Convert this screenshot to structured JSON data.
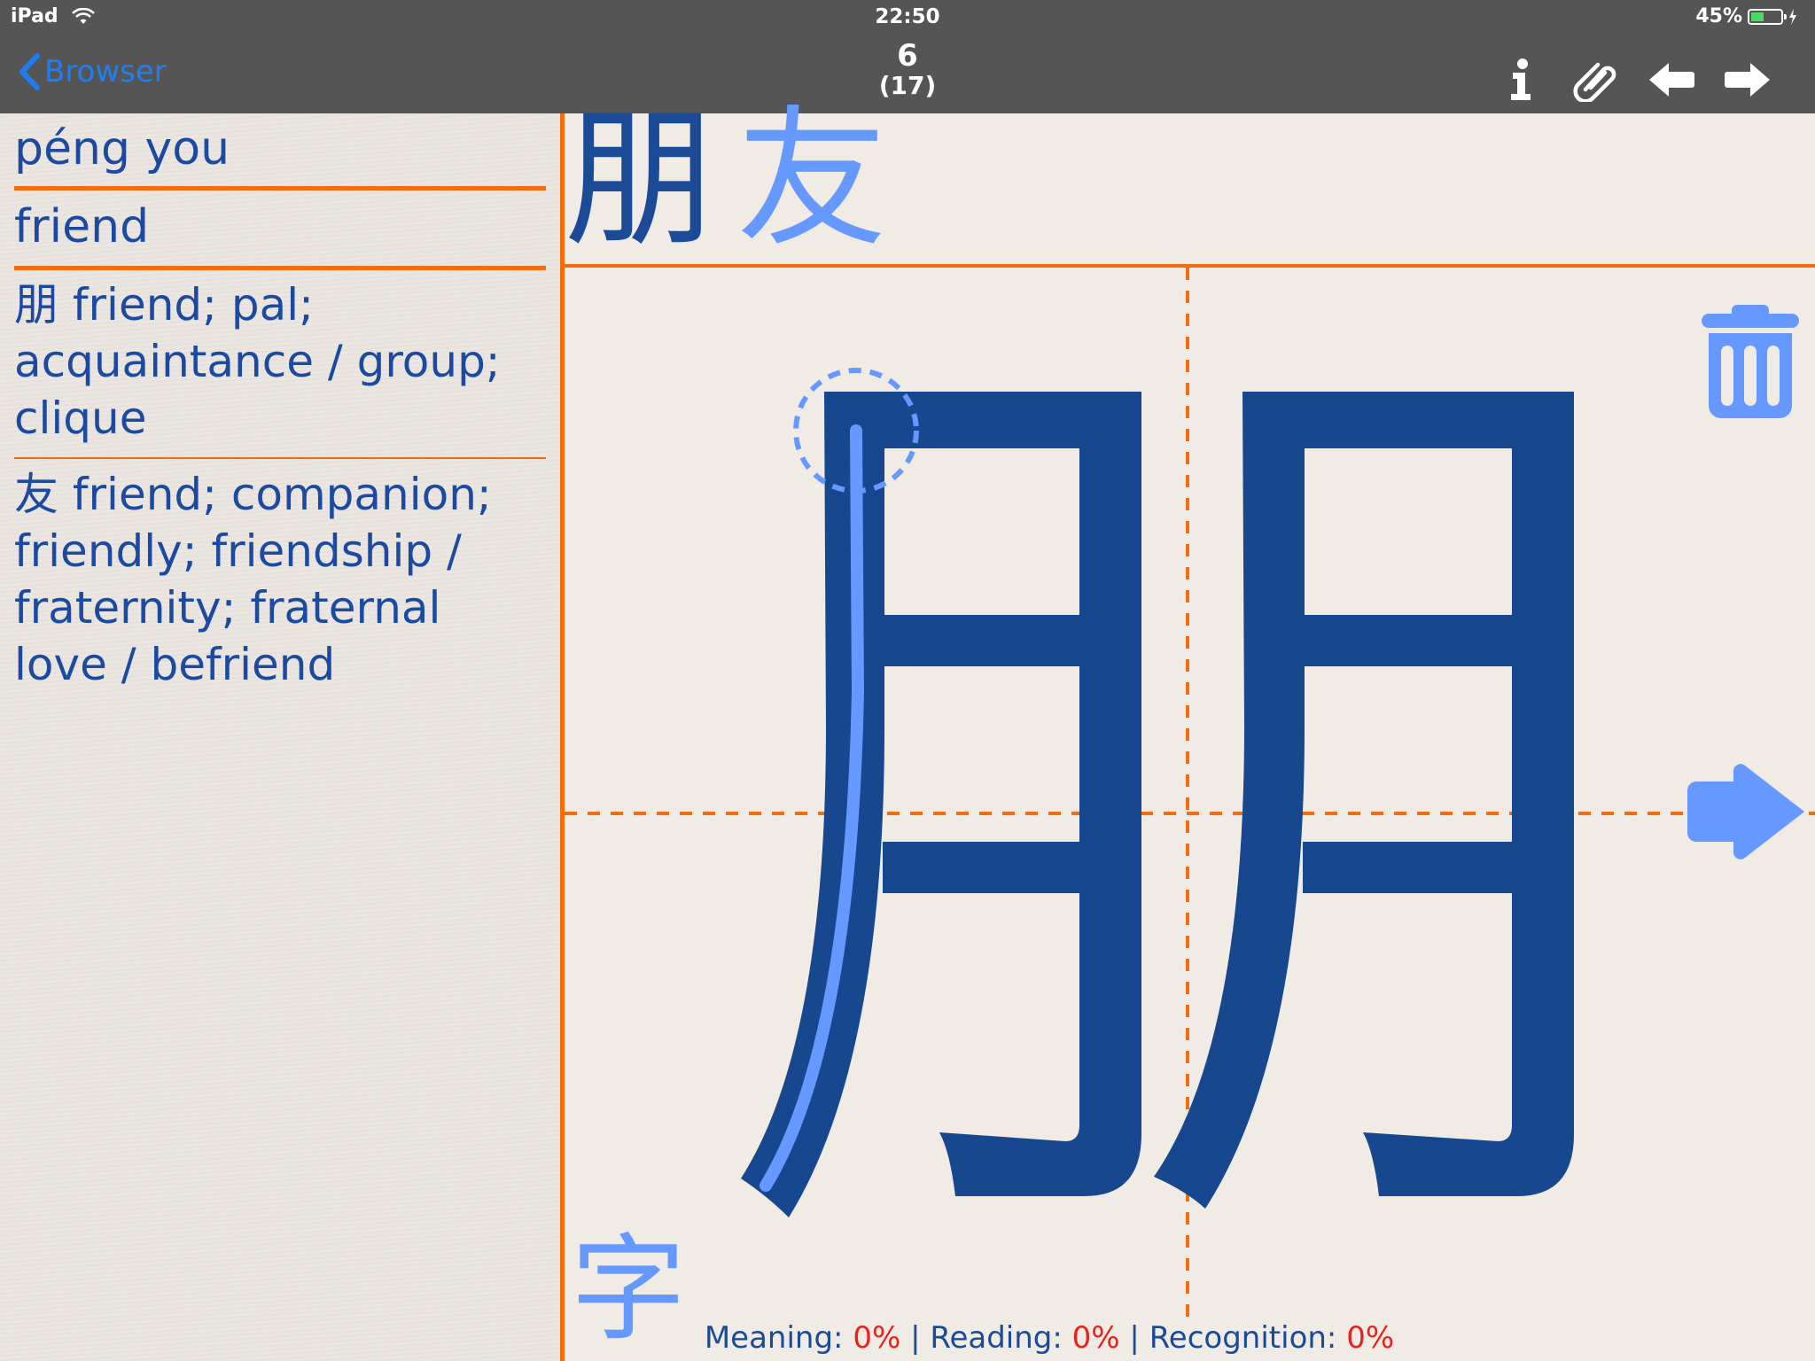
{
  "status_bar": {
    "device": "iPad",
    "time": "22:50",
    "battery": "45%",
    "battery_level": 0.45
  },
  "nav": {
    "back_label": "Browser",
    "title": "6",
    "subtitle": "(17)",
    "icons": [
      "info-icon",
      "paperclip-icon",
      "arrow-left-icon",
      "arrow-right-icon"
    ]
  },
  "left_panel": {
    "pinyin": "péng you",
    "meaning": "friend",
    "definition_1": "朋 friend; pal; acquaintance / group; clique",
    "definition_2": "友 friend; companion; friendly; friendship / fraternity; fraternal love / befriend"
  },
  "main": {
    "word_char_1": "朋",
    "word_char_2": "友",
    "practice_char": "朋",
    "mode_char": "字",
    "scores": {
      "meaning_label": "Meaning:",
      "meaning_value": "0%",
      "reading_label": "Reading:",
      "reading_value": "0%",
      "recognition_label": "Recognition:",
      "recognition_value": "0%",
      "separator": "|"
    }
  },
  "colors": {
    "accent_orange": "#f26c12",
    "char_dark_blue": "#1b4a96",
    "char_light_blue": "#6699ff",
    "link_blue": "#1e7ff5",
    "score_red": "#e8231d",
    "topbar_gray": "#555555"
  }
}
